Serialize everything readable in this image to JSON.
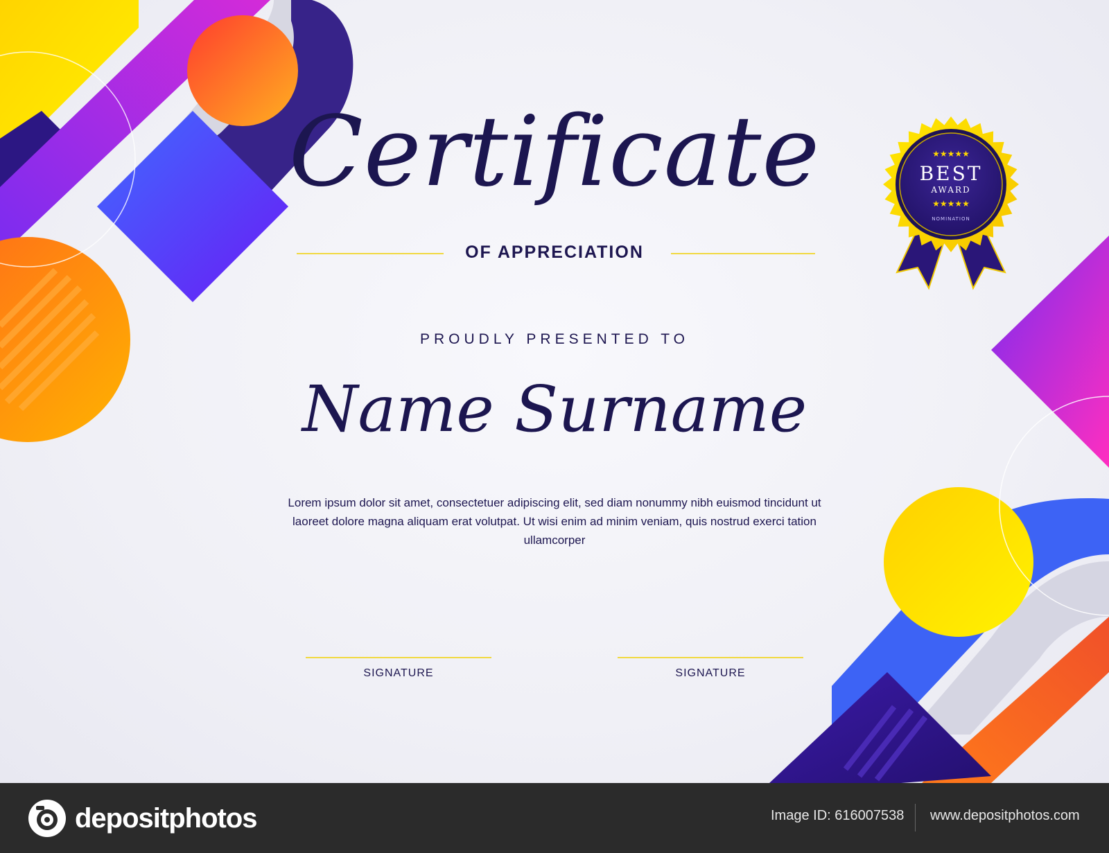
{
  "certificate": {
    "title": "Certificate",
    "subtitle": "OF APPRECIATION",
    "presented_label": "PROUDLY PRESENTED TO",
    "recipient": "Name Surname",
    "body_text": "Lorem ipsum dolor sit amet, consectetuer adipiscing elit, sed diam nonummy nibh euismod tincidunt ut laoreet dolore magna aliquam erat volutpat. Ut wisi enim ad minim veniam, quis nostrud exerci tation ullamcorper",
    "signatures": [
      {
        "label": "SIGNATURE"
      },
      {
        "label": "SIGNATURE"
      }
    ]
  },
  "badge": {
    "line1": "BEST",
    "line2": "AWARD",
    "line3": "NOMINATION",
    "stars": "★★★★★"
  },
  "footer": {
    "logo_text": "depositphotos",
    "image_id": "Image ID: 616007538",
    "url": "www.depositphotos.com"
  },
  "colors": {
    "navy": "#1d1650",
    "gold": "#f1d940",
    "purple": "#8a2be2",
    "blue": "#3b5bff",
    "orange": "#ff6a00",
    "yellow": "#ffe600",
    "footer_bg": "#2b2b2b"
  }
}
